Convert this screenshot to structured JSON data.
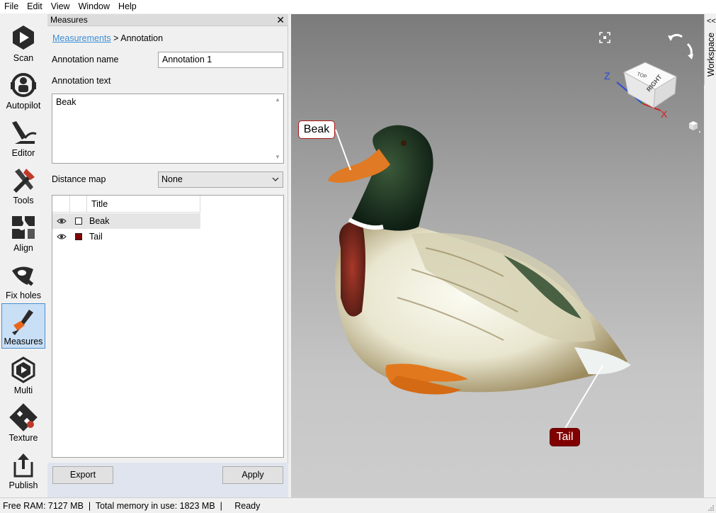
{
  "menu": [
    "File",
    "Edit",
    "View",
    "Window",
    "Help"
  ],
  "toolbar": {
    "tools": [
      {
        "label": "Scan"
      },
      {
        "label": "Autopilot"
      },
      {
        "label": "Editor"
      },
      {
        "label": "Tools"
      },
      {
        "label": "Align"
      },
      {
        "label": "Fix holes"
      },
      {
        "label": "Measures",
        "active": true
      },
      {
        "label": "Multi"
      },
      {
        "label": "Texture"
      },
      {
        "label": "Publish"
      }
    ]
  },
  "panel": {
    "title": "Measures",
    "close": "✕",
    "breadcrumb": {
      "link": "Measurements",
      "separator": " > ",
      "current": "Annotation"
    },
    "annotation_name_label": "Annotation name",
    "annotation_name_value": "Annotation 1",
    "annotation_text_label": "Annotation text",
    "annotation_text_value": "Beak",
    "distance_map_label": "Distance map",
    "distance_map_value": "None",
    "table": {
      "column_title": "Title",
      "rows": [
        {
          "title": "Beak",
          "color": "#ffffff",
          "selected": true
        },
        {
          "title": "Tail",
          "color": "#800000",
          "selected": false
        }
      ]
    },
    "export_label": "Export",
    "apply_label": "Apply"
  },
  "viewport": {
    "annotations": [
      {
        "text": "Beak",
        "bg": "#ffffff",
        "border": "#b01515"
      },
      {
        "text": "Tail",
        "bg": "#800000",
        "border": "#660000"
      }
    ],
    "nav_cube": {
      "top": "TOP",
      "right": "RIGHT",
      "z_axis": "Z",
      "x_axis": "X"
    }
  },
  "workspace": {
    "label": "Workspace",
    "chevron": "<<"
  },
  "status": {
    "text": "Free RAM: 7127 MB  |  Total memory in use: 1823 MB  |     Ready"
  }
}
